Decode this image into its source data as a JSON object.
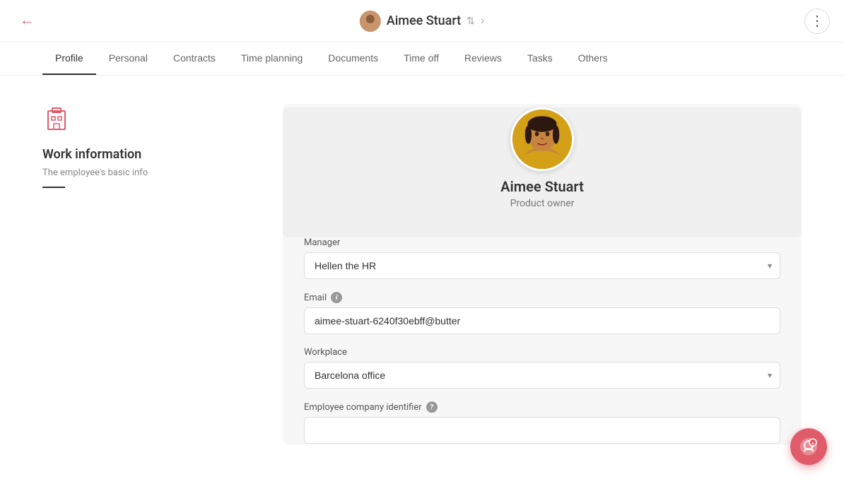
{
  "topBar": {
    "backIcon": "←",
    "employeeName": "Aimee Stuart",
    "sortIcon": "⇅",
    "forwardArrow": "›",
    "moreIcon": "⋮"
  },
  "tabs": [
    {
      "id": "profile",
      "label": "Profile",
      "active": true
    },
    {
      "id": "personal",
      "label": "Personal",
      "active": false
    },
    {
      "id": "contracts",
      "label": "Contracts",
      "active": false
    },
    {
      "id": "time-planning",
      "label": "Time planning",
      "active": false
    },
    {
      "id": "documents",
      "label": "Documents",
      "active": false
    },
    {
      "id": "time-off",
      "label": "Time off",
      "active": false
    },
    {
      "id": "reviews",
      "label": "Reviews",
      "active": false
    },
    {
      "id": "tasks",
      "label": "Tasks",
      "active": false
    },
    {
      "id": "others",
      "label": "Others",
      "active": false
    }
  ],
  "leftPanel": {
    "title": "Work information",
    "description": "The employee's basic info"
  },
  "profileCard": {
    "name": "Aimee Stuart",
    "role": "Product owner"
  },
  "form": {
    "managerLabel": "Manager",
    "managerValue": "Hellen the HR",
    "emailLabel": "Email",
    "emailValue": "aimee-stuart-6240f30ebff@butter",
    "workplaceLabel": "Workplace",
    "workplaceValue": "Barcelona office",
    "employeeIdLabel": "Employee company identifier",
    "employeeIdHelpIcon": "?",
    "employeeIdValue": ""
  }
}
